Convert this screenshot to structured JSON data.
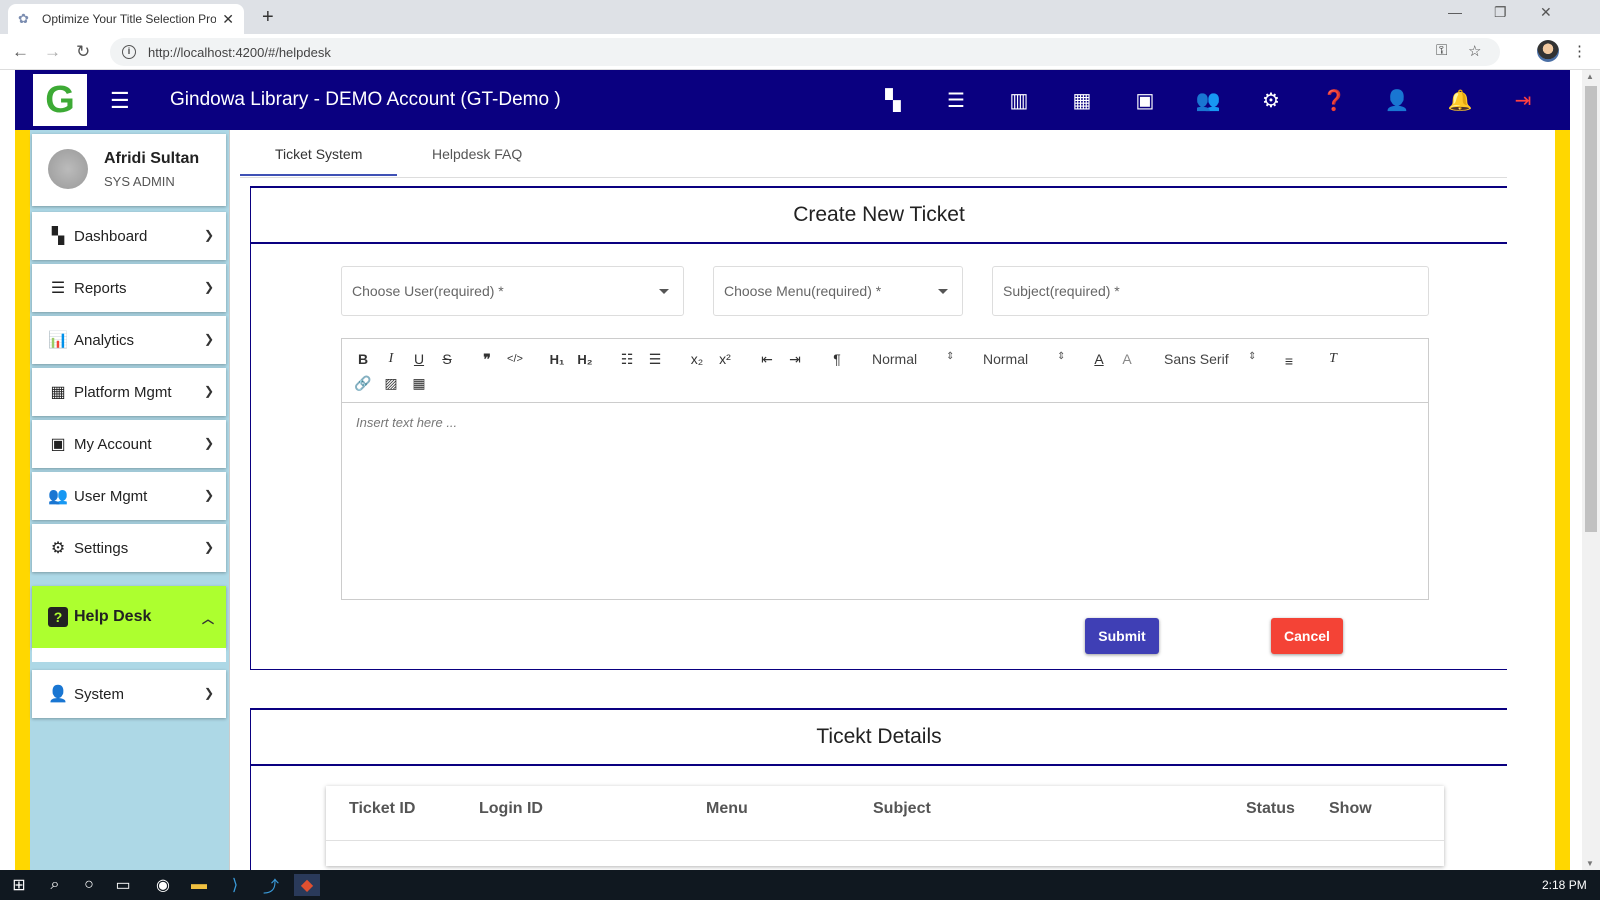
{
  "browser": {
    "tab_title": "Optimize Your Title Selection Pro",
    "url": "http://localhost:4200/#/helpdesk"
  },
  "header": {
    "title": "Gindowa Library - DEMO Account (GT-Demo )",
    "logo_letter": "G",
    "icons": [
      "dashboard-icon",
      "reports-icon",
      "analytics-icon",
      "platform-icon",
      "wallet-icon",
      "users-icon",
      "settings-icon",
      "help-icon",
      "system-icon",
      "bell-icon",
      "logout-icon"
    ]
  },
  "profile": {
    "name": "Afridi Sultan",
    "role": "SYS ADMIN"
  },
  "sidebar": {
    "items": [
      {
        "label": "Dashboard",
        "glyph": "▚"
      },
      {
        "label": "Reports",
        "glyph": "☰"
      },
      {
        "label": "Analytics",
        "glyph": "📊"
      },
      {
        "label": "Platform Mgmt",
        "glyph": "▦"
      },
      {
        "label": "My Account",
        "glyph": "▣"
      },
      {
        "label": "User Mgmt",
        "glyph": "👥"
      },
      {
        "label": "Settings",
        "glyph": "⚙"
      },
      {
        "label": "Help Desk",
        "glyph": "?"
      },
      {
        "label": "System",
        "glyph": "👤"
      }
    ]
  },
  "tabs": {
    "ticket_system": "Ticket System",
    "faq": "Helpdesk FAQ"
  },
  "create": {
    "title": "Create New Ticket",
    "user_placeholder": "Choose User(required) *",
    "menu_placeholder": "Choose Menu(required) *",
    "subject_placeholder": "Subject(required) *",
    "editor": {
      "size1": "Normal",
      "size2": "Normal",
      "font": "Sans Serif",
      "placeholder": "Insert text here ..."
    },
    "submit": "Submit",
    "cancel": "Cancel"
  },
  "details": {
    "title": "Ticekt Details",
    "columns": [
      "Ticket ID",
      "Login ID",
      "Menu",
      "Subject",
      "Status",
      "Show"
    ]
  },
  "taskbar": {
    "time": "2:18 PM"
  },
  "colors": {
    "header": "#0a0080",
    "sidebar": "#add8e6",
    "active": "#adff2f",
    "submit": "#3f3fb5",
    "cancel": "#f44336",
    "strip": "#ffd700"
  }
}
